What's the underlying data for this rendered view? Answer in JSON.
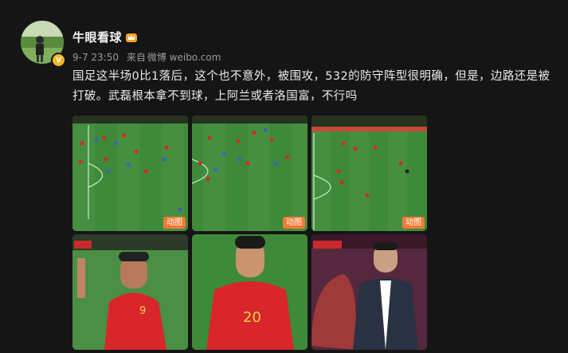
{
  "post": {
    "author": "牛眼看球",
    "time": "9-7 23:50",
    "from_label": "来自",
    "source": "微博 weibo.com",
    "text": "国足这半场0比1落后，这个也不意外，被围攻，532的防守阵型很明确，但是，边路还是被打破。武磊根本拿不到球，上阿兰或者洛国富，不行吗"
  },
  "images": [
    {
      "kind": "pitch",
      "gif_label": "动图"
    },
    {
      "kind": "pitch",
      "gif_label": "动图"
    },
    {
      "kind": "pitch",
      "gif_label": "动图"
    },
    {
      "kind": "player",
      "number": "9"
    },
    {
      "kind": "player",
      "number": "20"
    },
    {
      "kind": "coach"
    }
  ],
  "colors": {
    "china_red": "#d8262b",
    "gif_badge": "#f47a36",
    "pitch_green": "#3f8a3a"
  }
}
